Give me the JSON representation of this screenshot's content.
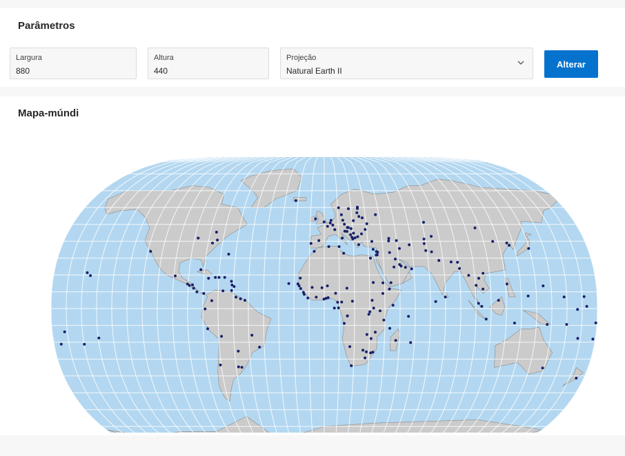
{
  "parameters": {
    "title": "Parâmetros",
    "width": {
      "label": "Largura",
      "value": "880"
    },
    "height": {
      "label": "Altura",
      "value": "440"
    },
    "projection": {
      "label": "Projeção",
      "value": "Natural Earth II"
    },
    "apply_label": "Alterar"
  },
  "map": {
    "title": "Mapa-múndi",
    "colors": {
      "ocean": "#b3d7f0",
      "land": "#cbcbcb",
      "border": "#8a8a8a",
      "graticule": "#ffffff",
      "marker": "#17206b"
    },
    "markers": [
      {
        "lon": -74.0,
        "lat": 40.7
      },
      {
        "lon": -77.0,
        "lat": 38.9
      },
      {
        "lon": -87.6,
        "lat": 41.9
      },
      {
        "lon": -118.2,
        "lat": 34.0
      },
      {
        "lon": -99.1,
        "lat": 19.4
      },
      {
        "lon": -90.5,
        "lat": 14.6
      },
      {
        "lon": -89.2,
        "lat": 13.7
      },
      {
        "lon": -87.2,
        "lat": 14.1
      },
      {
        "lon": -86.3,
        "lat": 12.1
      },
      {
        "lon": -84.1,
        "lat": 9.9
      },
      {
        "lon": -79.5,
        "lat": 9.0
      },
      {
        "lon": -82.4,
        "lat": 23.1
      },
      {
        "lon": -76.8,
        "lat": 18.0
      },
      {
        "lon": -72.3,
        "lat": 18.5
      },
      {
        "lon": -69.9,
        "lat": 18.5
      },
      {
        "lon": -66.1,
        "lat": 18.5
      },
      {
        "lon": -61.5,
        "lat": 16.2
      },
      {
        "lon": -61.0,
        "lat": 14.0
      },
      {
        "lon": -59.6,
        "lat": 13.1
      },
      {
        "lon": -61.2,
        "lat": 10.7
      },
      {
        "lon": -66.9,
        "lat": 10.5
      },
      {
        "lon": -74.1,
        "lat": 4.7
      },
      {
        "lon": -78.5,
        "lat": -0.2
      },
      {
        "lon": -77.0,
        "lat": -12.0
      },
      {
        "lon": -68.1,
        "lat": -16.5
      },
      {
        "lon": -70.6,
        "lat": -33.5
      },
      {
        "lon": -58.4,
        "lat": -34.6
      },
      {
        "lon": -56.2,
        "lat": -34.9
      },
      {
        "lon": -57.6,
        "lat": -25.3
      },
      {
        "lon": -47.9,
        "lat": -15.8
      },
      {
        "lon": -43.2,
        "lat": -22.9
      },
      {
        "lon": -58.2,
        "lat": 6.8
      },
      {
        "lon": -55.2,
        "lat": 5.8
      },
      {
        "lon": -52.3,
        "lat": 4.9
      },
      {
        "lon": -75.7,
        "lat": 45.4
      },
      {
        "lon": -64.8,
        "lat": 32.3
      },
      {
        "lon": -21.9,
        "lat": 64.1
      },
      {
        "lon": -0.1,
        "lat": 51.5
      },
      {
        "lon": -6.3,
        "lat": 53.3
      },
      {
        "lon": 2.35,
        "lat": 48.9
      },
      {
        "lon": -3.7,
        "lat": 40.4
      },
      {
        "lon": -9.1,
        "lat": 38.7
      },
      {
        "lon": 4.9,
        "lat": 52.4
      },
      {
        "lon": 4.35,
        "lat": 50.8
      },
      {
        "lon": 6.1,
        "lat": 49.6
      },
      {
        "lon": 13.4,
        "lat": 52.5
      },
      {
        "lon": 12.6,
        "lat": 55.7
      },
      {
        "lon": 10.75,
        "lat": 59.9
      },
      {
        "lon": 18.1,
        "lat": 59.3
      },
      {
        "lon": 24.9,
        "lat": 60.2
      },
      {
        "lon": 24.1,
        "lat": 56.9
      },
      {
        "lon": 24.8,
        "lat": 59.4
      },
      {
        "lon": 25.3,
        "lat": 54.7
      },
      {
        "lon": 21.0,
        "lat": 52.2
      },
      {
        "lon": 14.4,
        "lat": 50.1
      },
      {
        "lon": 17.1,
        "lat": 48.1
      },
      {
        "lon": 16.4,
        "lat": 48.2
      },
      {
        "lon": 19.0,
        "lat": 47.5
      },
      {
        "lon": 7.45,
        "lat": 46.9
      },
      {
        "lon": 12.5,
        "lat": 41.9
      },
      {
        "lon": 14.5,
        "lat": 46.0
      },
      {
        "lon": 16.0,
        "lat": 45.8
      },
      {
        "lon": 18.4,
        "lat": 43.9
      },
      {
        "lon": 20.5,
        "lat": 44.8
      },
      {
        "lon": 19.3,
        "lat": 42.4
      },
      {
        "lon": 19.8,
        "lat": 41.3
      },
      {
        "lon": 21.4,
        "lat": 42.0
      },
      {
        "lon": 23.7,
        "lat": 38.0
      },
      {
        "lon": 23.3,
        "lat": 42.7
      },
      {
        "lon": 26.1,
        "lat": 44.4
      },
      {
        "lon": 28.9,
        "lat": 47.0
      },
      {
        "lon": 30.5,
        "lat": 50.4
      },
      {
        "lon": 27.6,
        "lat": 53.9
      },
      {
        "lon": 37.6,
        "lat": 55.8
      },
      {
        "lon": 32.9,
        "lat": 39.9
      },
      {
        "lon": 33.4,
        "lat": 35.2
      },
      {
        "lon": 35.5,
        "lat": 33.9
      },
      {
        "lon": 36.3,
        "lat": 33.5
      },
      {
        "lon": 35.2,
        "lat": 31.8
      },
      {
        "lon": 35.9,
        "lat": 31.9
      },
      {
        "lon": 44.8,
        "lat": 41.7
      },
      {
        "lon": 44.5,
        "lat": 40.2
      },
      {
        "lon": 49.9,
        "lat": 40.4
      },
      {
        "lon": 44.4,
        "lat": 33.3
      },
      {
        "lon": 51.4,
        "lat": 35.7
      },
      {
        "lon": 47.9,
        "lat": 29.4
      },
      {
        "lon": 46.7,
        "lat": 24.7
      },
      {
        "lon": 50.6,
        "lat": 26.2
      },
      {
        "lon": 51.5,
        "lat": 25.3
      },
      {
        "lon": 54.4,
        "lat": 24.5
      },
      {
        "lon": 58.4,
        "lat": 23.6
      },
      {
        "lon": 44.2,
        "lat": 15.4
      },
      {
        "lon": 69.2,
        "lat": 34.5
      },
      {
        "lon": 73.0,
        "lat": 33.7
      },
      {
        "lon": 77.2,
        "lat": 28.6
      },
      {
        "lon": 85.3,
        "lat": 27.7
      },
      {
        "lon": 89.6,
        "lat": 27.5
      },
      {
        "lon": 90.4,
        "lat": 23.8
      },
      {
        "lon": 79.9,
        "lat": 6.9
      },
      {
        "lon": 73.5,
        "lat": 4.2
      },
      {
        "lon": 96.1,
        "lat": 19.7
      },
      {
        "lon": 100.5,
        "lat": 13.8
      },
      {
        "lon": 102.6,
        "lat": 18.0
      },
      {
        "lon": 104.9,
        "lat": 11.6
      },
      {
        "lon": 105.8,
        "lat": 21.0
      },
      {
        "lon": 101.7,
        "lat": 3.1
      },
      {
        "lon": 103.8,
        "lat": 1.3
      },
      {
        "lon": 114.9,
        "lat": 4.9
      },
      {
        "lon": 106.8,
        "lat": -6.2
      },
      {
        "lon": 125.6,
        "lat": -8.6
      },
      {
        "lon": 121.0,
        "lat": 14.6
      },
      {
        "lon": 116.4,
        "lat": 39.9
      },
      {
        "lon": 106.9,
        "lat": 47.9
      },
      {
        "lon": 125.8,
        "lat": 39.0
      },
      {
        "lon": 127.0,
        "lat": 37.6
      },
      {
        "lon": 139.7,
        "lat": 35.7
      },
      {
        "lon": 71.4,
        "lat": 51.2
      },
      {
        "lon": 69.2,
        "lat": 41.3
      },
      {
        "lon": 74.6,
        "lat": 42.9
      },
      {
        "lon": 68.8,
        "lat": 38.6
      },
      {
        "lon": 58.4,
        "lat": 37.9
      },
      {
        "lon": 31.2,
        "lat": 30.0
      },
      {
        "lon": 13.2,
        "lat": 32.9
      },
      {
        "lon": 10.2,
        "lat": 36.8
      },
      {
        "lon": 3.1,
        "lat": 36.8
      },
      {
        "lon": -6.8,
        "lat": 34.0
      },
      {
        "lon": -15.9,
        "lat": 18.1
      },
      {
        "lon": -17.4,
        "lat": 14.7
      },
      {
        "lon": -16.6,
        "lat": 13.5
      },
      {
        "lon": -15.6,
        "lat": 11.9
      },
      {
        "lon": -13.7,
        "lat": 9.6
      },
      {
        "lon": -13.2,
        "lat": 8.5
      },
      {
        "lon": -10.8,
        "lat": 6.3
      },
      {
        "lon": -5.3,
        "lat": 6.8
      },
      {
        "lon": -0.2,
        "lat": 5.6
      },
      {
        "lon": 1.2,
        "lat": 6.1
      },
      {
        "lon": 2.6,
        "lat": 6.5
      },
      {
        "lon": 7.5,
        "lat": 9.1
      },
      {
        "lon": -8.0,
        "lat": 12.6
      },
      {
        "lon": -1.5,
        "lat": 12.4
      },
      {
        "lon": 2.1,
        "lat": 13.5
      },
      {
        "lon": 15.0,
        "lat": 12.1
      },
      {
        "lon": 11.5,
        "lat": 3.9
      },
      {
        "lon": 8.8,
        "lat": 3.75
      },
      {
        "lon": 18.6,
        "lat": 4.4
      },
      {
        "lon": 9.4,
        "lat": 0.4
      },
      {
        "lon": 15.3,
        "lat": -4.3
      },
      {
        "lon": 15.3,
        "lat": -4.4
      },
      {
        "lon": 13.2,
        "lat": -8.8
      },
      {
        "lon": 32.5,
        "lat": 15.5
      },
      {
        "lon": 31.6,
        "lat": 4.9
      },
      {
        "lon": 38.7,
        "lat": 9.0
      },
      {
        "lon": 38.9,
        "lat": 15.3
      },
      {
        "lon": 43.1,
        "lat": 11.6
      },
      {
        "lon": 45.3,
        "lat": 2.0
      },
      {
        "lon": 32.6,
        "lat": 0.3
      },
      {
        "lon": 36.8,
        "lat": -1.3
      },
      {
        "lon": 30.1,
        "lat": -1.9
      },
      {
        "lon": 29.4,
        "lat": -3.4
      },
      {
        "lon": 39.3,
        "lat": -6.8
      },
      {
        "lon": 28.3,
        "lat": -15.4
      },
      {
        "lon": 33.8,
        "lat": -14.0
      },
      {
        "lon": 31.1,
        "lat": -17.8
      },
      {
        "lon": 32.6,
        "lat": -25.9
      },
      {
        "lon": 25.9,
        "lat": -24.7
      },
      {
        "lon": 17.1,
        "lat": -22.6
      },
      {
        "lon": 28.2,
        "lat": -25.7
      },
      {
        "lon": 27.5,
        "lat": -29.3
      },
      {
        "lon": 31.1,
        "lat": -26.3
      },
      {
        "lon": 18.4,
        "lat": -33.9
      },
      {
        "lon": 47.5,
        "lat": -18.9
      },
      {
        "lon": 57.5,
        "lat": -20.2
      },
      {
        "lon": 55.5,
        "lat": -4.6
      },
      {
        "lon": 43.3,
        "lat": -11.7
      },
      {
        "lon": -23.5,
        "lat": 14.9
      },
      {
        "lon": 6.7,
        "lat": 0.3
      },
      {
        "lon": 149.1,
        "lat": -35.3
      },
      {
        "lon": 174.8,
        "lat": -41.3
      },
      {
        "lon": 147.2,
        "lat": -9.4
      },
      {
        "lon": 160.0,
        "lat": -9.4
      },
      {
        "lon": 168.3,
        "lat": -17.7
      },
      {
        "lon": 178.4,
        "lat": -18.1
      },
      {
        "lon": -171.8,
        "lat": -13.8
      },
      {
        "lon": -175.2,
        "lat": -21.1
      },
      {
        "lon": 173.0,
        "lat": 1.3
      },
      {
        "lon": 171.4,
        "lat": 7.1
      },
      {
        "lon": 158.2,
        "lat": 6.9
      },
      {
        "lon": 134.5,
        "lat": 7.5
      },
      {
        "lon": 144.8,
        "lat": 13.5
      },
      {
        "lon": -157.9,
        "lat": 21.3
      },
      {
        "lon": -155.5,
        "lat": 19.6
      },
      {
        "lon": -149.6,
        "lat": -17.5
      },
      {
        "lon": -159.8,
        "lat": -21.2
      },
      {
        "lon": 179.2,
        "lat": -8.5
      },
      {
        "lon": 166.9,
        "lat": -0.5
      }
    ]
  }
}
